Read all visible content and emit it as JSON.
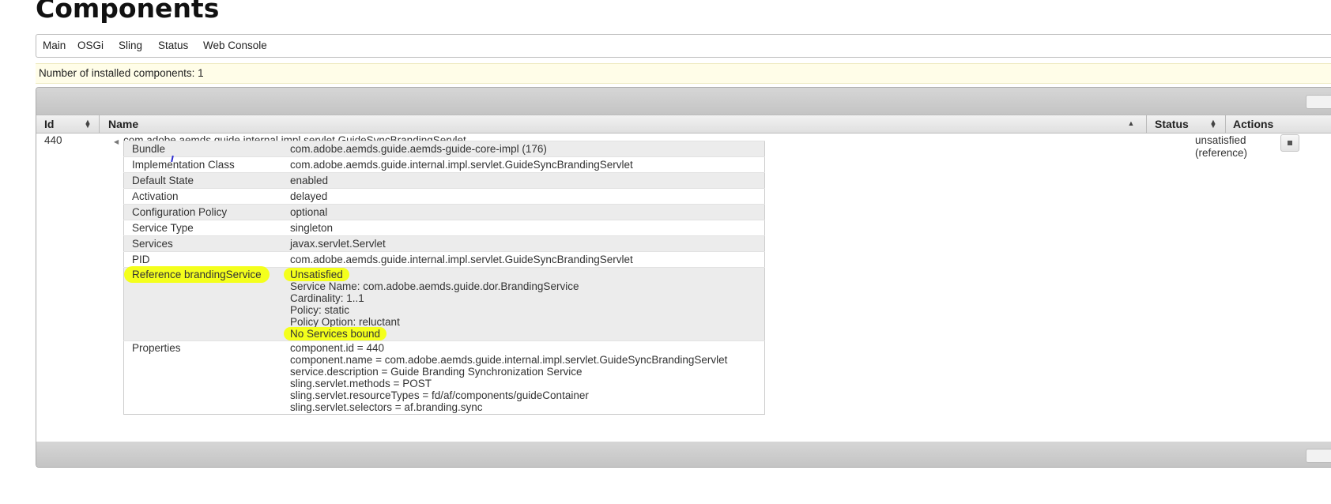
{
  "page": {
    "title": "Components"
  },
  "nav": {
    "items": [
      "Main",
      "OSGi",
      "Sling",
      "Status",
      "Web Console"
    ]
  },
  "status_line": "Number of installed components: 1",
  "table": {
    "headers": {
      "id": "Id",
      "name": "Name",
      "status": "Status",
      "actions": "Actions"
    },
    "row": {
      "id": "440",
      "name": "com.adobe.aemds.guide.internal.impl.servlet.GuideSyncBrandingServlet",
      "status_line1": "unsatisfied",
      "status_line2": "(reference)"
    }
  },
  "details": {
    "bundle": {
      "key": "Bundle",
      "value": "com.adobe.aemds.guide.aemds-guide-core-impl (176)"
    },
    "impl": {
      "key": "Implementation Class",
      "value": "com.adobe.aemds.guide.internal.impl.servlet.GuideSyncBrandingServlet"
    },
    "default_state": {
      "key": "Default State",
      "value": "enabled"
    },
    "activation": {
      "key": "Activation",
      "value": "delayed"
    },
    "config_policy": {
      "key": "Configuration Policy",
      "value": "optional"
    },
    "service_type": {
      "key": "Service Type",
      "value": "singleton"
    },
    "services": {
      "key": "Services",
      "value": "javax.servlet.Servlet"
    },
    "pid": {
      "key": "PID",
      "value": "com.adobe.aemds.guide.internal.impl.servlet.GuideSyncBrandingServlet"
    },
    "reference": {
      "key": "Reference brandingService",
      "lines": [
        "Unsatisfied",
        "Service Name: com.adobe.aemds.guide.dor.BrandingService",
        "Cardinality: 1..1",
        "Policy: static",
        "Policy Option: reluctant",
        "No Services bound"
      ]
    },
    "properties": {
      "key": "Properties",
      "lines": [
        "component.id = 440",
        "component.name = com.adobe.aemds.guide.internal.impl.servlet.GuideSyncBrandingServlet",
        "service.description = Guide Branding Synchronization Service",
        "sling.servlet.methods = POST",
        "sling.servlet.resourceTypes = fd/af/components/guideContainer",
        "sling.servlet.selectors = af.branding.sync"
      ]
    }
  },
  "colors": {
    "highlight": "#f4ff1c",
    "status_bg": "#fffde8",
    "header_gradient": "#d6d6d6"
  },
  "icons": {
    "expand": "triangle-left-icon",
    "sort": "sort-both-icon",
    "sort_up": "sort-ascending-icon",
    "action": "stop-square-icon"
  }
}
